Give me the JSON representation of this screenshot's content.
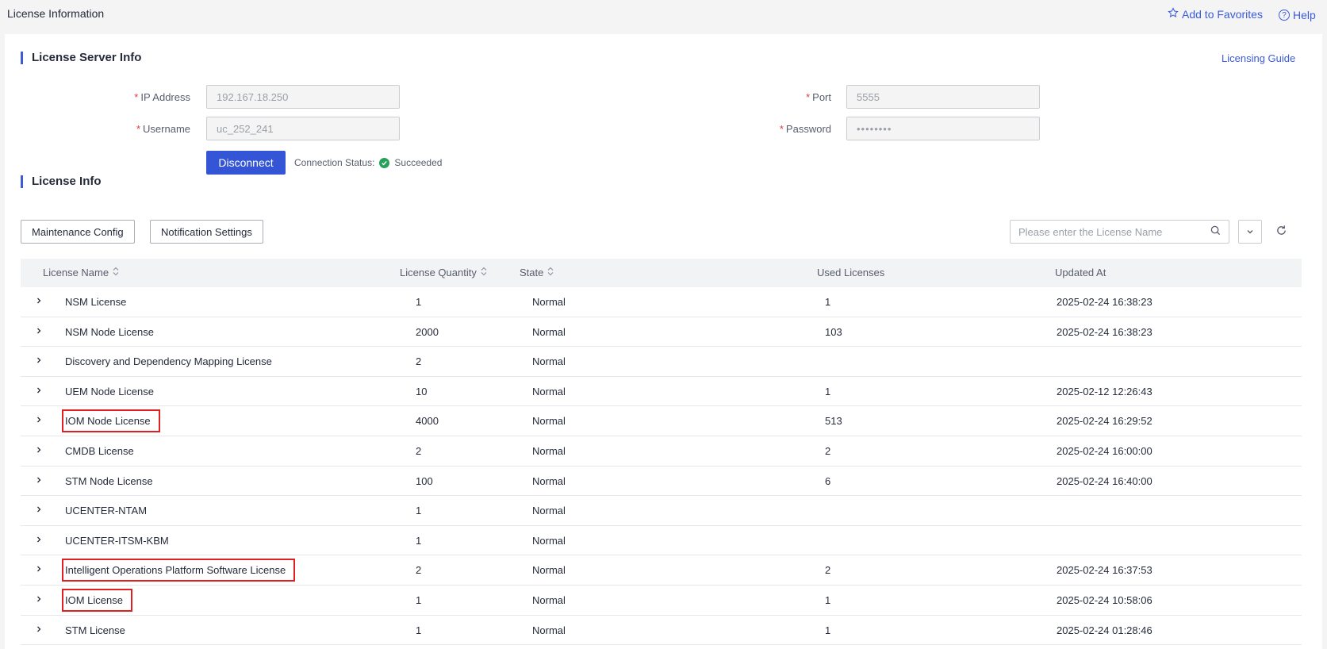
{
  "header": {
    "page_title": "License Information",
    "add_favorites": "Add to Favorites",
    "help": "Help"
  },
  "server_info": {
    "title": "License Server Info",
    "licensing_guide": "Licensing Guide",
    "ip_label": "IP Address",
    "ip_value": "192.167.18.250",
    "port_label": "Port",
    "port_value": "5555",
    "username_label": "Username",
    "username_value": "uc_252_241",
    "password_label": "Password",
    "password_value": "••••••••",
    "disconnect": "Disconnect",
    "conn_label": "Connection Status:",
    "conn_value": "Succeeded",
    "required_mark": "*"
  },
  "license_info": {
    "title": "License Info",
    "maintenance_config": "Maintenance Config",
    "notification_settings": "Notification Settings",
    "search_placeholder": "Please enter the License Name"
  },
  "table": {
    "columns": [
      "License Name",
      "License Quantity",
      "State",
      "Used Licenses",
      "Updated At"
    ],
    "rows": [
      {
        "name": "NSM License",
        "quantity": "1",
        "state": "Normal",
        "used": "1",
        "updated": "2025-02-24 16:38:23",
        "highlighted": false
      },
      {
        "name": "NSM Node License",
        "quantity": "2000",
        "state": "Normal",
        "used": "103",
        "updated": "2025-02-24 16:38:23",
        "highlighted": false
      },
      {
        "name": "Discovery and Dependency Mapping License",
        "quantity": "2",
        "state": "Normal",
        "used": "",
        "updated": "",
        "highlighted": false
      },
      {
        "name": "UEM Node License",
        "quantity": "10",
        "state": "Normal",
        "used": "1",
        "updated": "2025-02-12 12:26:43",
        "highlighted": false
      },
      {
        "name": "IOM Node License",
        "quantity": "4000",
        "state": "Normal",
        "used": "513",
        "updated": "2025-02-24 16:29:52",
        "highlighted": true
      },
      {
        "name": "CMDB License",
        "quantity": "2",
        "state": "Normal",
        "used": "2",
        "updated": "2025-02-24 16:00:00",
        "highlighted": false
      },
      {
        "name": "STM Node License",
        "quantity": "100",
        "state": "Normal",
        "used": "6",
        "updated": "2025-02-24 16:40:00",
        "highlighted": false
      },
      {
        "name": "UCENTER-NTAM",
        "quantity": "1",
        "state": "Normal",
        "used": "",
        "updated": "",
        "highlighted": false
      },
      {
        "name": "UCENTER-ITSM-KBM",
        "quantity": "1",
        "state": "Normal",
        "used": "",
        "updated": "",
        "highlighted": false
      },
      {
        "name": "Intelligent Operations Platform Software License",
        "quantity": "2",
        "state": "Normal",
        "used": "2",
        "updated": "2025-02-24 16:37:53",
        "highlighted": true
      },
      {
        "name": "IOM License",
        "quantity": "1",
        "state": "Normal",
        "used": "1",
        "updated": "2025-02-24 10:58:06",
        "highlighted": true
      },
      {
        "name": "STM License",
        "quantity": "1",
        "state": "Normal",
        "used": "1",
        "updated": "2025-02-24 01:28:46",
        "highlighted": false
      }
    ]
  },
  "colors": {
    "accent": "#3355d6",
    "success": "#27a05a",
    "highlight_box": "#e02020",
    "required": "#e0393e"
  },
  "icons": [
    "star-icon",
    "help-icon",
    "check-circle-icon",
    "search-icon",
    "chevron-down-icon",
    "refresh-icon",
    "sort-icon",
    "chevron-right-icon"
  ]
}
